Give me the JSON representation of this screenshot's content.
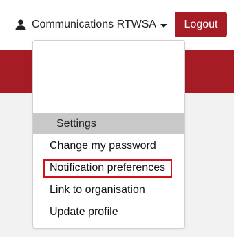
{
  "header": {
    "user_name": "Communications RTWSA",
    "user_icon": "person-icon",
    "logout_label": "Logout"
  },
  "user_menu": {
    "section_header": "Settings",
    "items": [
      {
        "label": "Change my password"
      },
      {
        "label": "Notification preferences",
        "highlighted": true
      },
      {
        "label": "Link to organisation"
      },
      {
        "label": "Update profile"
      }
    ]
  },
  "colors": {
    "brand": "#a51c24",
    "highlight_outline": "#d0121b",
    "section_header_bg": "#c8c8c8"
  }
}
